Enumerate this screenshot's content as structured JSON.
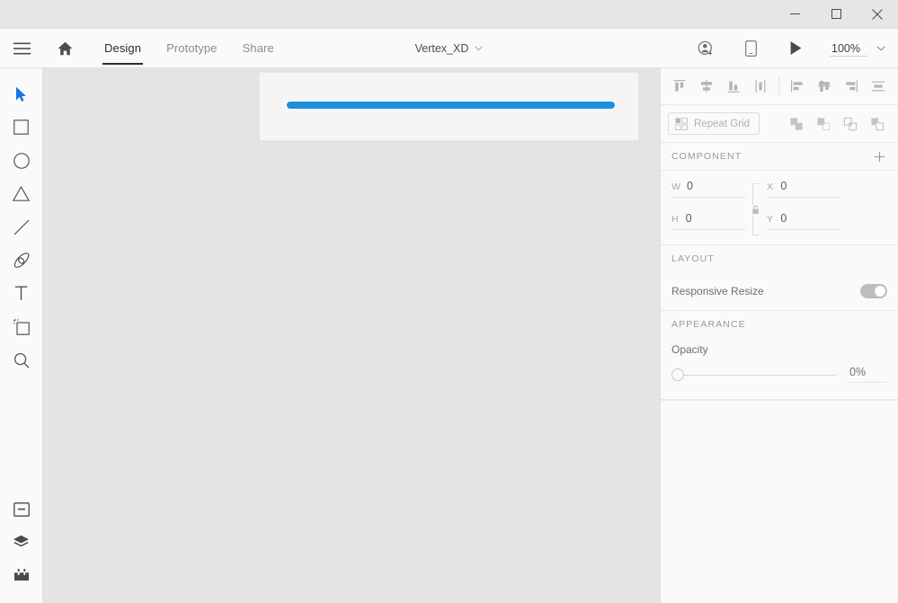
{
  "window": {
    "minimize_label": "Minimize",
    "maximize_label": "Maximize",
    "close_label": "Close"
  },
  "toolbar": {
    "hamburger_label": "Menu",
    "home_label": "Home",
    "tabs": [
      {
        "label": "Design",
        "active": true
      },
      {
        "label": "Prototype",
        "active": false
      },
      {
        "label": "Share",
        "active": false
      }
    ],
    "document_title": "Vertex_XD",
    "coedit_label": "Invite to edit",
    "device_preview_label": "Device preview",
    "play_label": "Desktop preview",
    "zoom_value": "100%"
  },
  "tools": [
    {
      "name": "select-tool",
      "label": "Select",
      "active": true
    },
    {
      "name": "rectangle-tool",
      "label": "Rectangle",
      "active": false
    },
    {
      "name": "ellipse-tool",
      "label": "Ellipse",
      "active": false
    },
    {
      "name": "polygon-tool",
      "label": "Polygon",
      "active": false
    },
    {
      "name": "line-tool",
      "label": "Line",
      "active": false
    },
    {
      "name": "pen-tool",
      "label": "Pen",
      "active": false
    },
    {
      "name": "text-tool",
      "label": "Text",
      "active": false
    },
    {
      "name": "artboard-tool",
      "label": "Artboard",
      "active": false
    },
    {
      "name": "zoom-tool",
      "label": "Zoom",
      "active": false
    }
  ],
  "tools_bottom": [
    {
      "name": "assets-panel-toggle",
      "label": "Assets"
    },
    {
      "name": "layers-panel-toggle",
      "label": "Layers"
    },
    {
      "name": "plugins-panel-toggle",
      "label": "Plugins"
    }
  ],
  "canvas": {
    "artboard_name": "",
    "shape_color": "#1d8fdd",
    "background_color": "#e4e4e4",
    "artboard_background": "#f5f5f5"
  },
  "panel": {
    "align": {
      "vertical": [
        {
          "name": "align-top-button",
          "label": "Align top"
        },
        {
          "name": "align-vertical-center-button",
          "label": "Align vertical center"
        },
        {
          "name": "align-bottom-button",
          "label": "Align bottom"
        },
        {
          "name": "distribute-vertical-button",
          "label": "Distribute vertically"
        }
      ],
      "horizontal": [
        {
          "name": "align-left-button",
          "label": "Align left"
        },
        {
          "name": "align-horizontal-center-button",
          "label": "Align horizontal center"
        },
        {
          "name": "align-right-button",
          "label": "Align right"
        },
        {
          "name": "distribute-horizontal-button",
          "label": "Distribute horizontally"
        }
      ]
    },
    "repeat_grid_label": "Repeat Grid",
    "boolean_ops": [
      {
        "name": "boolean-add-button",
        "label": "Add"
      },
      {
        "name": "boolean-subtract-button",
        "label": "Subtract"
      },
      {
        "name": "boolean-intersect-button",
        "label": "Intersect"
      },
      {
        "name": "boolean-exclude-button",
        "label": "Exclude Overlap"
      }
    ],
    "component": {
      "header": "COMPONENT",
      "add_label": "+",
      "w_label": "W",
      "w_value": "0",
      "h_label": "H",
      "h_value": "0",
      "x_label": "X",
      "x_value": "0",
      "y_label": "Y",
      "y_value": "0",
      "lock_aspect_label": "Lock aspect ratio"
    },
    "layout": {
      "header": "LAYOUT",
      "responsive_resize_label": "Responsive Resize",
      "responsive_resize_on": true
    },
    "appearance": {
      "header": "APPEARANCE",
      "opacity_label": "Opacity",
      "opacity_value": "0%"
    }
  }
}
